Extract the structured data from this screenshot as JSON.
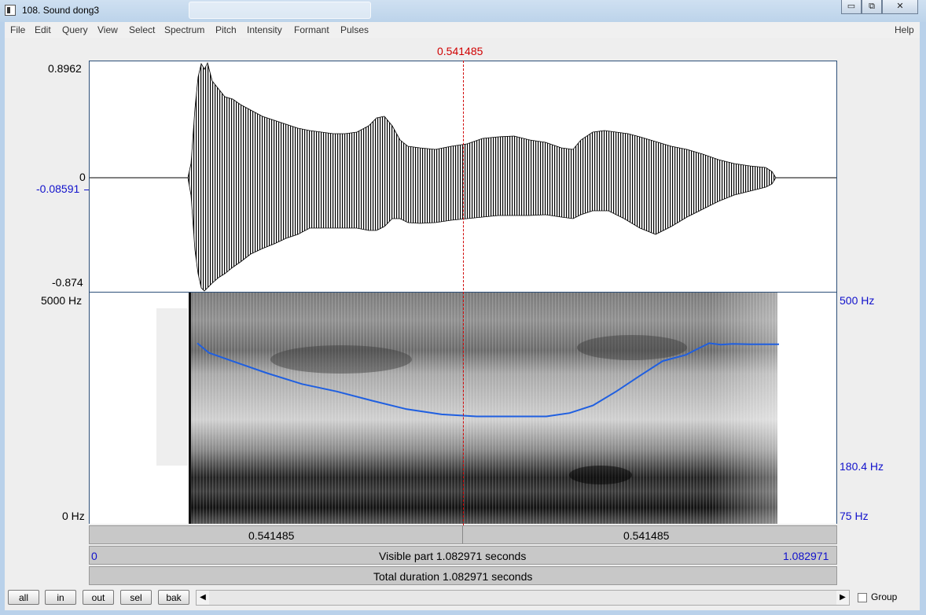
{
  "window": {
    "title": "108. Sound dong3",
    "minimize_glyph": "▭",
    "maximize_glyph": "⧉",
    "close_glyph": "✕"
  },
  "menu": [
    "File",
    "Edit",
    "Query",
    "View",
    "Select",
    "Spectrum",
    "Pitch",
    "Intensity",
    "Formant",
    "Pulses"
  ],
  "menu_help": "Help",
  "cursor_time": "0.541485",
  "waveform": {
    "ymax_label": "0.8962",
    "zero_label": "0",
    "value_label": "-0.08591",
    "ymin_label": "-0.874"
  },
  "spectrogram": {
    "top_freq_label": "5000 Hz",
    "bottom_freq_label": "0 Hz",
    "pitch_top_label": "500 Hz",
    "pitch_value_label": "180.4 Hz",
    "pitch_bottom_label": "75 Hz",
    "pitch_color": "#1f5fe0"
  },
  "bars": {
    "left_segment": "0.541485",
    "right_segment": "0.541485",
    "visible_start": "0",
    "visible_text": "Visible part 1.082971 seconds",
    "visible_end": "1.082971",
    "total_text": "Total duration 1.082971 seconds"
  },
  "buttons": {
    "all": "all",
    "in": "in",
    "out": "out",
    "sel": "sel",
    "bak": "bak"
  },
  "scroll": {
    "left_icon": "◀",
    "right_icon": "▶"
  },
  "group_label": "Group",
  "pitch_track_hz": [
    {
      "t": 0.0,
      "hz": 330
    },
    {
      "t": 0.02,
      "hz": 305
    },
    {
      "t": 0.06,
      "hz": 285
    },
    {
      "t": 0.12,
      "hz": 258
    },
    {
      "t": 0.18,
      "hz": 236
    },
    {
      "t": 0.24,
      "hz": 222
    },
    {
      "t": 0.3,
      "hz": 206
    },
    {
      "t": 0.36,
      "hz": 192
    },
    {
      "t": 0.42,
      "hz": 184
    },
    {
      "t": 0.48,
      "hz": 181
    },
    {
      "t": 0.54,
      "hz": 181
    },
    {
      "t": 0.6,
      "hz": 181
    },
    {
      "t": 0.64,
      "hz": 186
    },
    {
      "t": 0.68,
      "hz": 198
    },
    {
      "t": 0.72,
      "hz": 222
    },
    {
      "t": 0.76,
      "hz": 252
    },
    {
      "t": 0.8,
      "hz": 285
    },
    {
      "t": 0.84,
      "hz": 300
    },
    {
      "t": 0.86,
      "hz": 315
    },
    {
      "t": 0.88,
      "hz": 330
    },
    {
      "t": 0.9,
      "hz": 326
    },
    {
      "t": 0.92,
      "hz": 328
    },
    {
      "t": 0.95,
      "hz": 327
    },
    {
      "t": 1.0,
      "hz": 327
    }
  ]
}
